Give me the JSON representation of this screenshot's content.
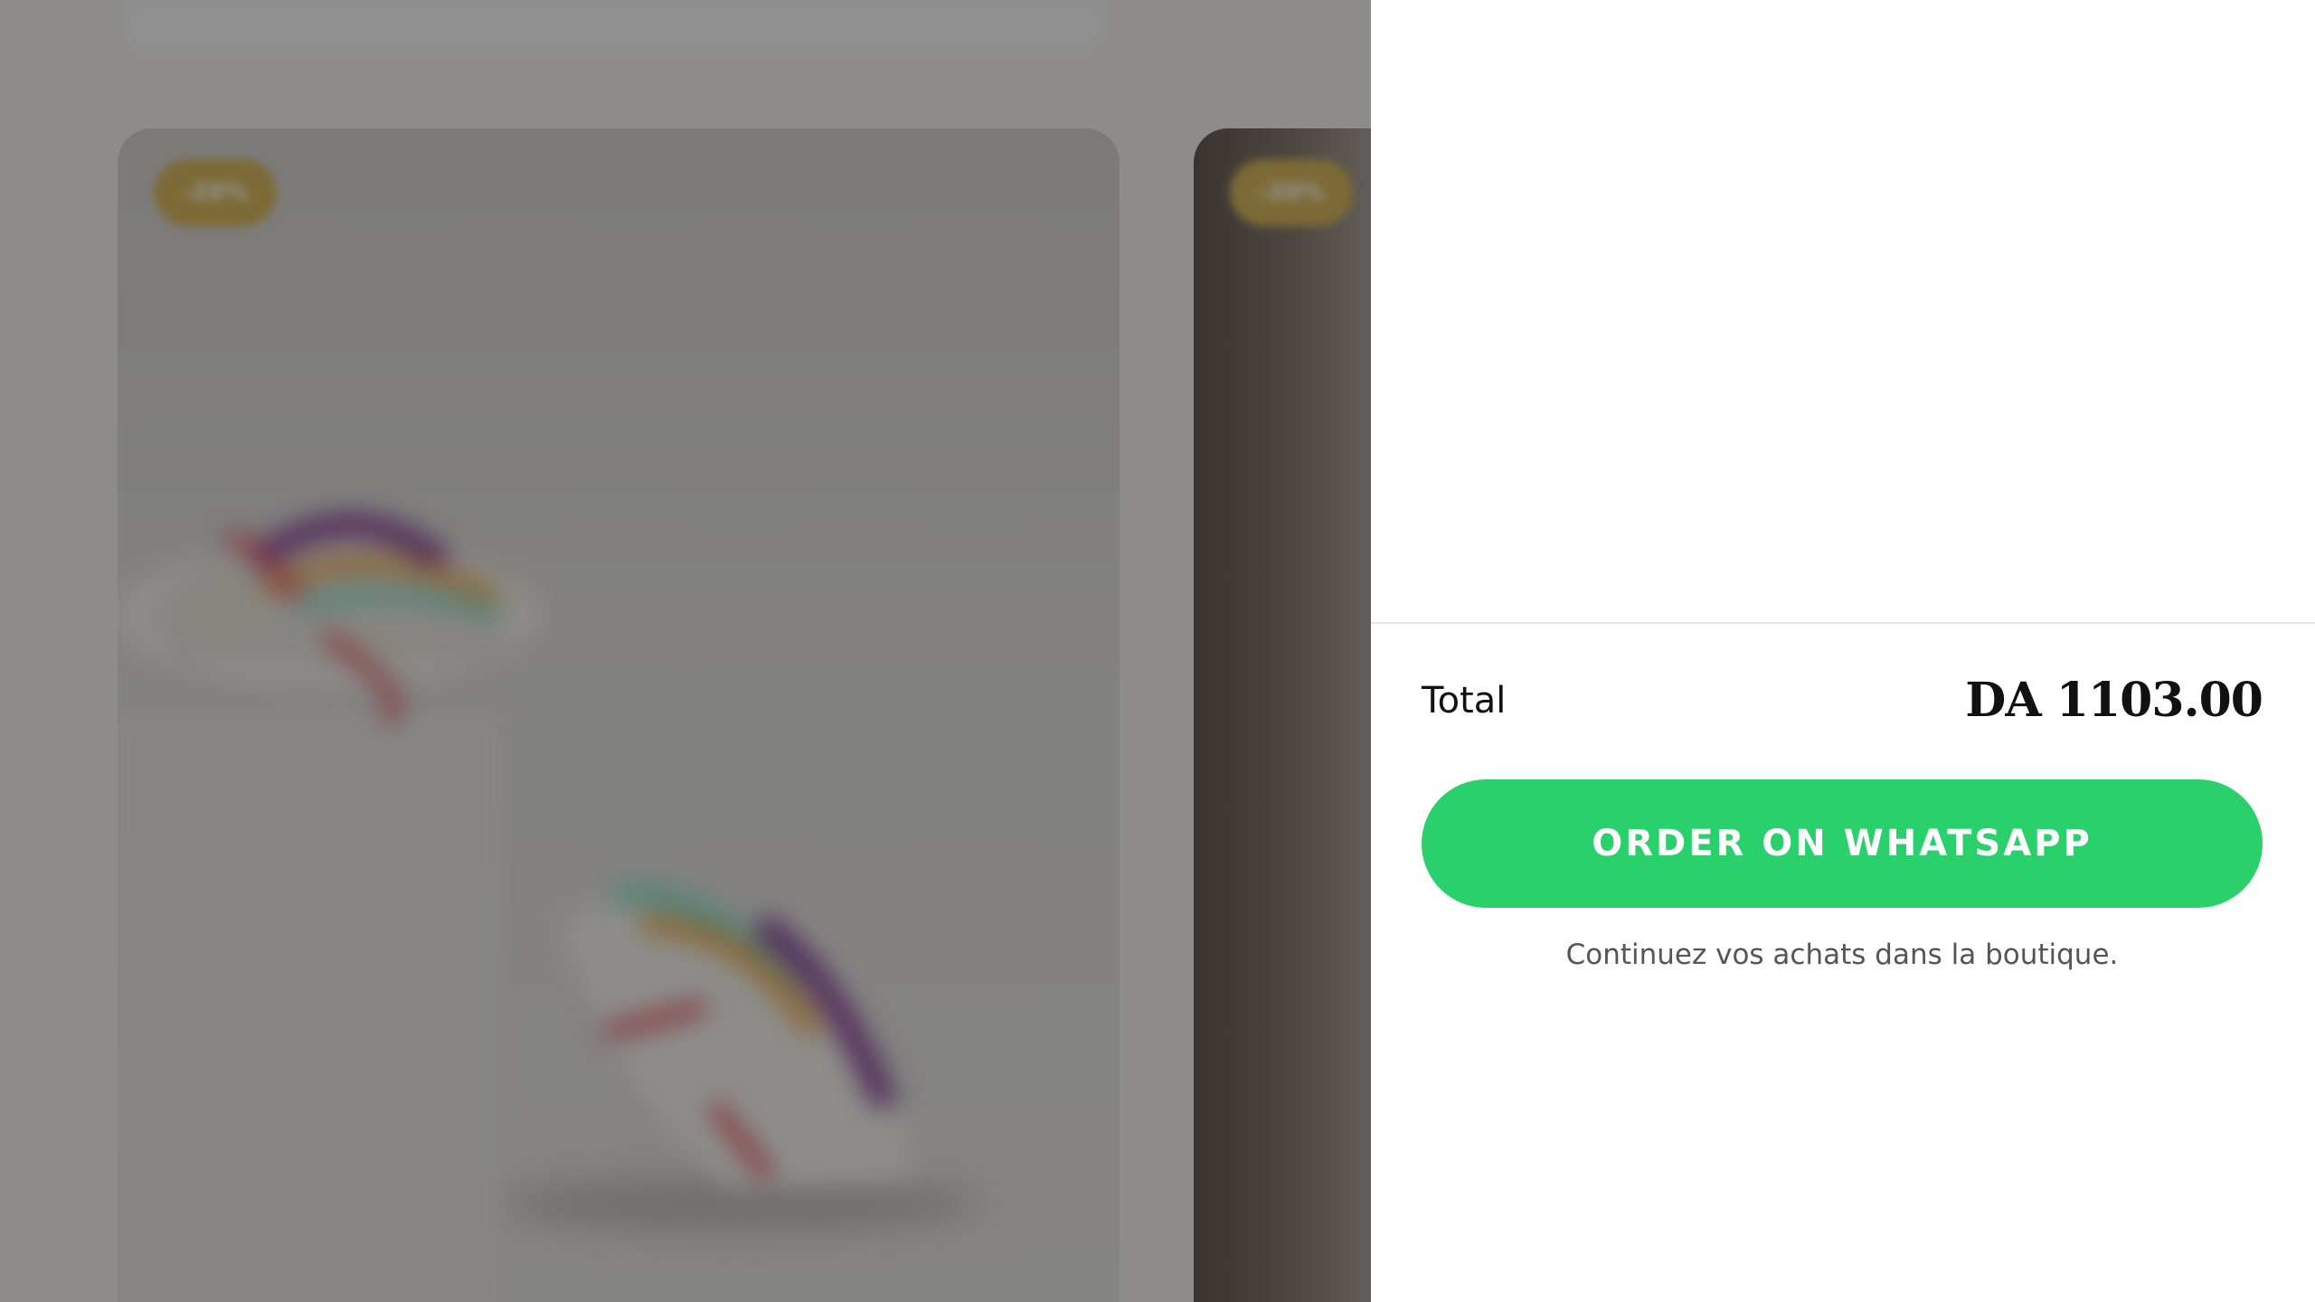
{
  "storefront": {
    "products": [
      {
        "badge": "-20%"
      },
      {
        "badge": "-20%"
      }
    ]
  },
  "cart": {
    "total_label": "Total",
    "total_amount": "DA 1103.00",
    "order_button_label": "ORDER ON WHATSAPP",
    "continue_shopping_text": "Continuez vos achats dans la boutique.",
    "colors": {
      "accent": "#2ad06b",
      "text": "#111111",
      "divider": "#e9e6dd",
      "badge": "#d2ad44"
    }
  }
}
